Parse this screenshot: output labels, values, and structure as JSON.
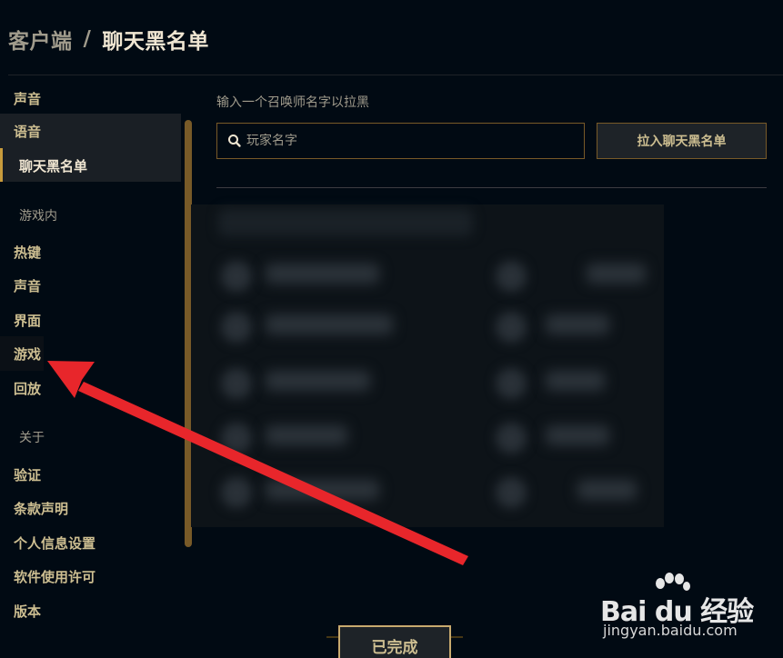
{
  "header": {
    "breadcrumb_root": "客户端",
    "breadcrumb_separator": "/",
    "title": "聊天黑名单"
  },
  "sidebar": {
    "items_top": [
      {
        "label": "声音"
      },
      {
        "label": "语音"
      },
      {
        "label": "聊天黑名单",
        "selected": true
      }
    ],
    "section_ingame": "游戏内",
    "items_ingame": [
      {
        "label": "热键"
      },
      {
        "label": "声音"
      },
      {
        "label": "界面"
      },
      {
        "label": "游戏"
      },
      {
        "label": "回放"
      }
    ],
    "section_about": "关于",
    "items_about": [
      {
        "label": "验证"
      },
      {
        "label": "条款声明"
      },
      {
        "label": "个人信息设置"
      },
      {
        "label": "软件使用许可"
      },
      {
        "label": "版本"
      }
    ]
  },
  "blacklist": {
    "input_label": "输入一个召唤师名字以拉黑",
    "input_placeholder": "玩家名字",
    "input_value": "",
    "add_button": "拉入聊天黑名单"
  },
  "footer": {
    "done_button": "已完成"
  },
  "watermark": {
    "logo": "Bai du 经验",
    "url": "jingyan.baidu.com"
  },
  "colors": {
    "background": "#010a13",
    "gold": "#c8aa6e",
    "gold_dark": "#785a28",
    "text_gold": "#cdbe91",
    "text_light": "#f0e6d2",
    "text_muted": "#a09b8c",
    "arrow": "#e8262b"
  }
}
